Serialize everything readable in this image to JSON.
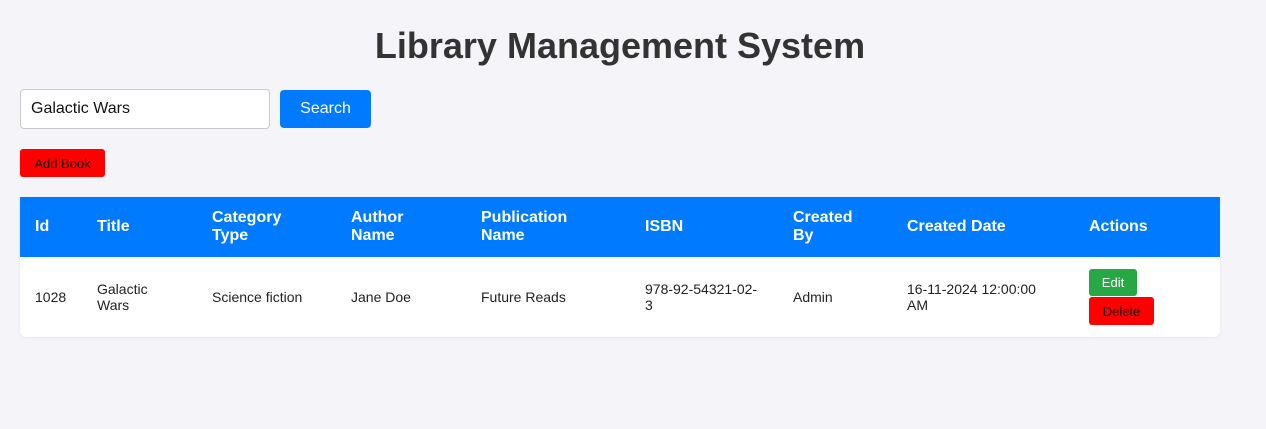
{
  "header": {
    "title": "Library Management System"
  },
  "search": {
    "value": "Galactic Wars",
    "placeholder": "",
    "button_label": "Search"
  },
  "toolbar": {
    "add_label": "Add Book"
  },
  "table": {
    "columns": [
      "Id",
      "Title",
      "Category Type",
      "Author Name",
      "Publication Name",
      "ISBN",
      "Created By",
      "Created Date",
      "Actions"
    ],
    "rows": [
      {
        "id": "1028",
        "title": "Galactic Wars",
        "category": "Science fiction",
        "author": "Jane Doe",
        "publication": "Future Reads",
        "isbn": "978-92-54321-02-3",
        "created_by": "Admin",
        "created_date": "16-11-2024 12:00:00 AM",
        "edit_label": "Edit",
        "delete_label": "Delete"
      }
    ]
  },
  "colors": {
    "primary": "#007bff",
    "danger": "#ff0000",
    "success": "#28a745",
    "background": "#f4f4f9"
  }
}
